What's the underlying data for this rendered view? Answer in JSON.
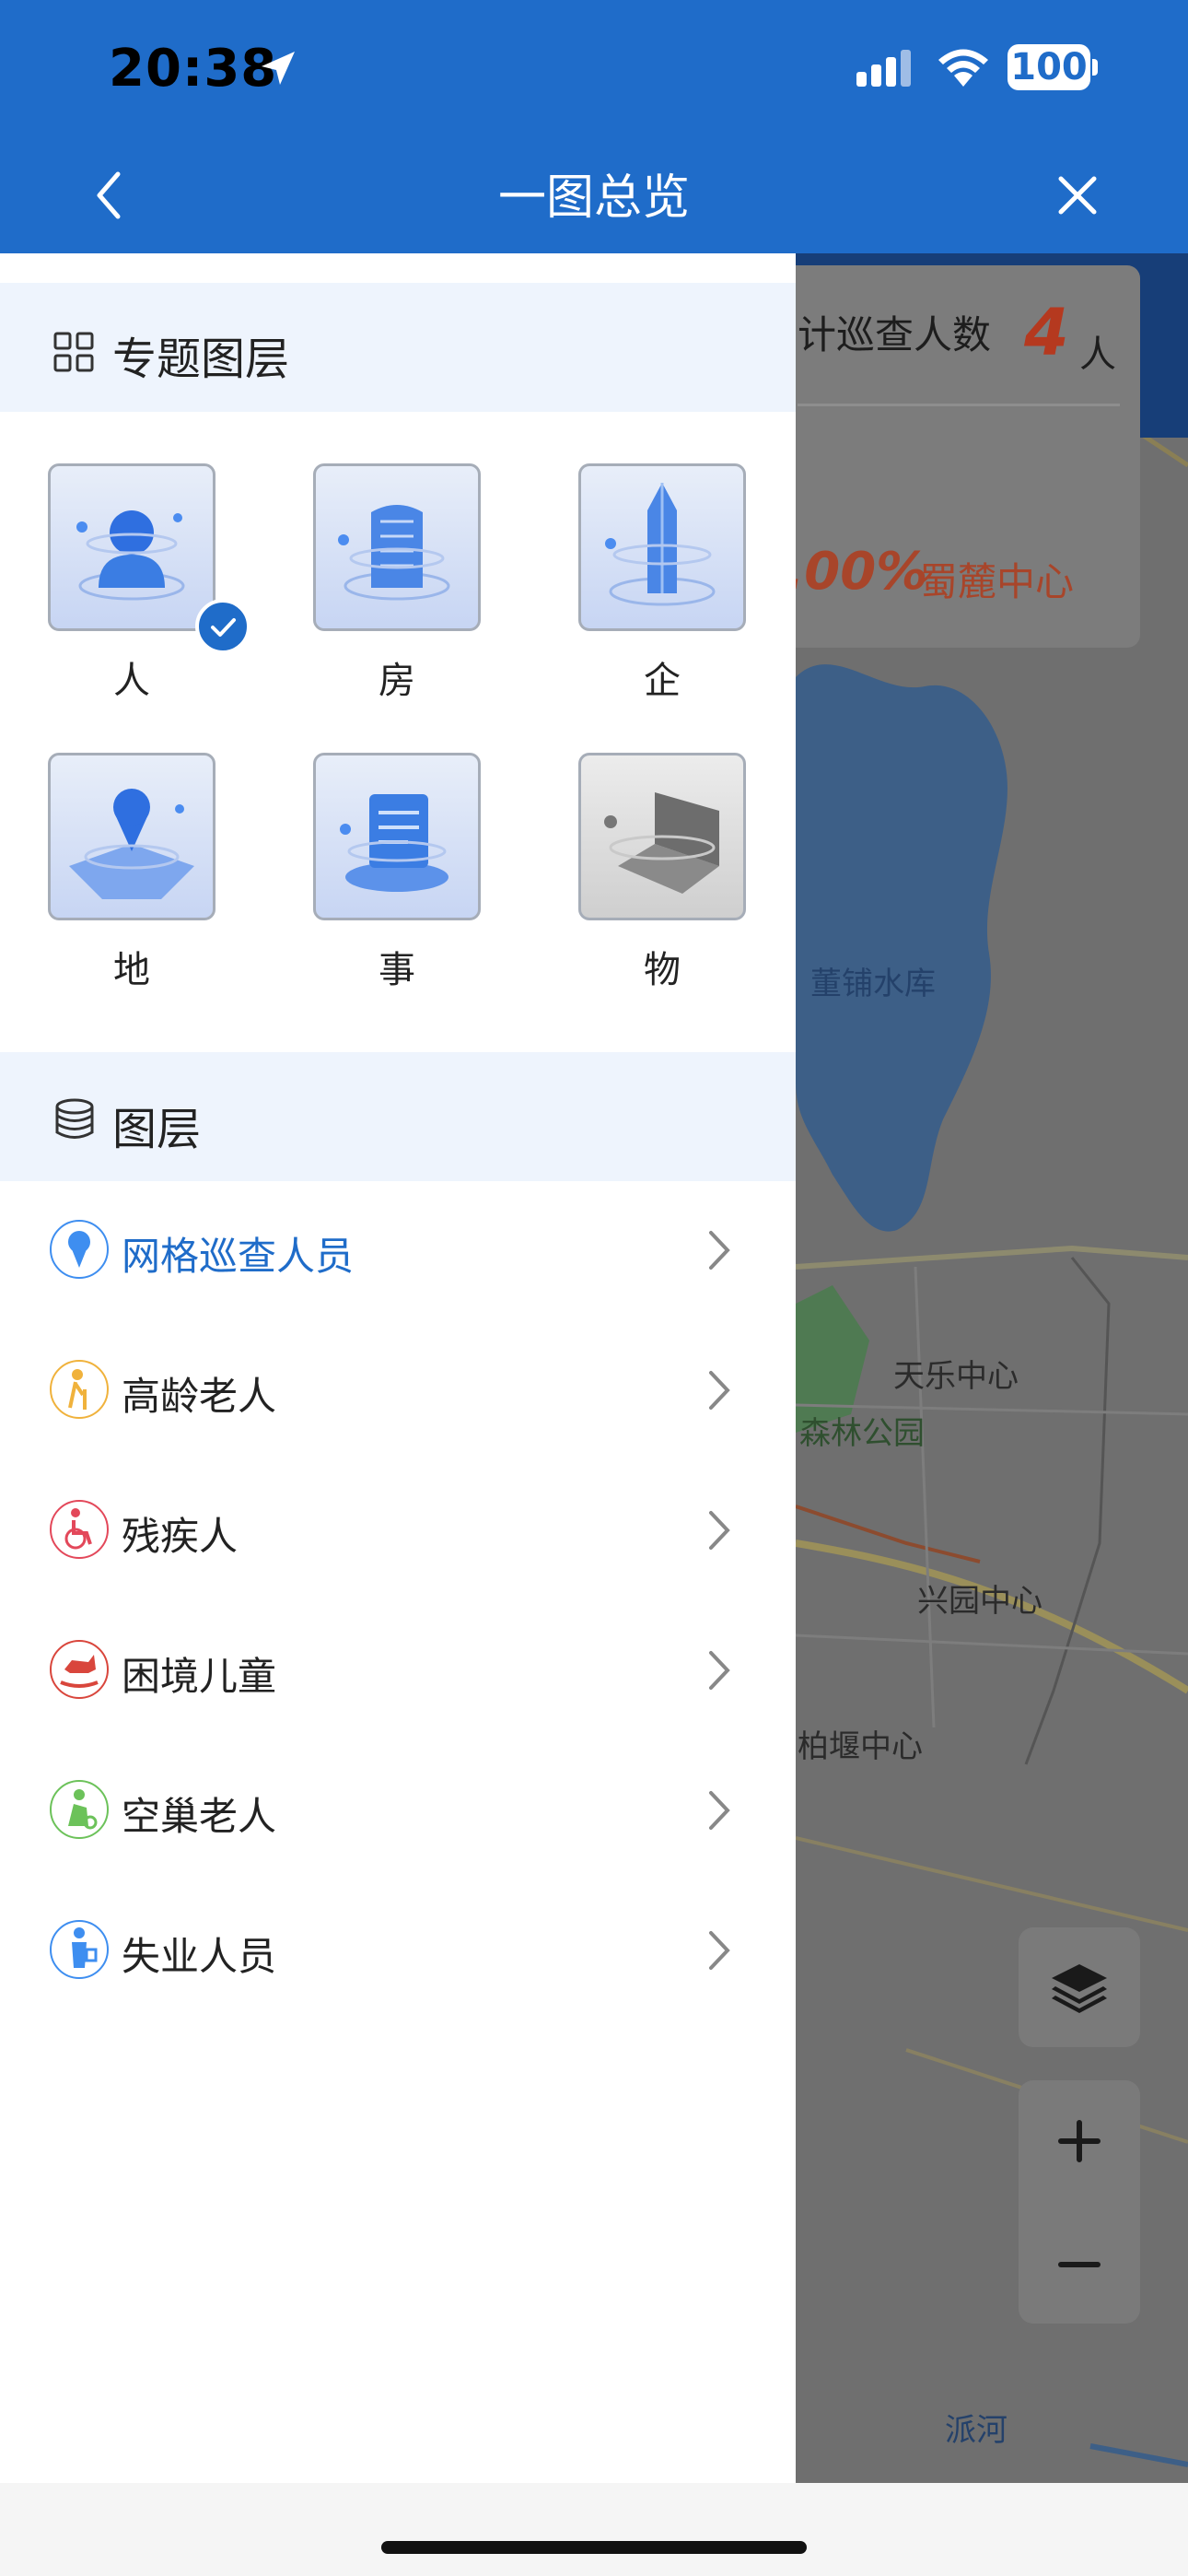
{
  "status_bar": {
    "time": "20:38",
    "battery": "100"
  },
  "nav": {
    "title": "一图总览"
  },
  "map": {
    "card_text": "计巡查人数",
    "card_number": "4",
    "card_unit": "人",
    "card_percent": ".00%",
    "card_place": "蜀麓中心",
    "labels": [
      "董铺水库",
      "天乐中心",
      "森林公园",
      "兴园中心",
      "柏堰中心",
      "派河"
    ]
  },
  "drawer": {
    "topic_section_title": "专题图层",
    "topics": [
      {
        "label": "人",
        "selected": true
      },
      {
        "label": "房",
        "selected": false
      },
      {
        "label": "企",
        "selected": false
      },
      {
        "label": "地",
        "selected": false
      },
      {
        "label": "事",
        "selected": false
      },
      {
        "label": "物",
        "selected": false
      }
    ],
    "layer_section_title": "图层",
    "layers": [
      {
        "label": "网格巡查人员",
        "active": true,
        "color": "#3e8ef0"
      },
      {
        "label": "高龄老人",
        "active": false,
        "color": "#f0b23c"
      },
      {
        "label": "残疾人",
        "active": false,
        "color": "#e3485a"
      },
      {
        "label": "困境儿童",
        "active": false,
        "color": "#d9463c"
      },
      {
        "label": "空巢老人",
        "active": false,
        "color": "#6cc25a"
      },
      {
        "label": "失业人员",
        "active": false,
        "color": "#3e8ef0"
      }
    ]
  },
  "colors": {
    "brand_blue": "#1f6cc9",
    "section_bg": "#eef4fd"
  }
}
